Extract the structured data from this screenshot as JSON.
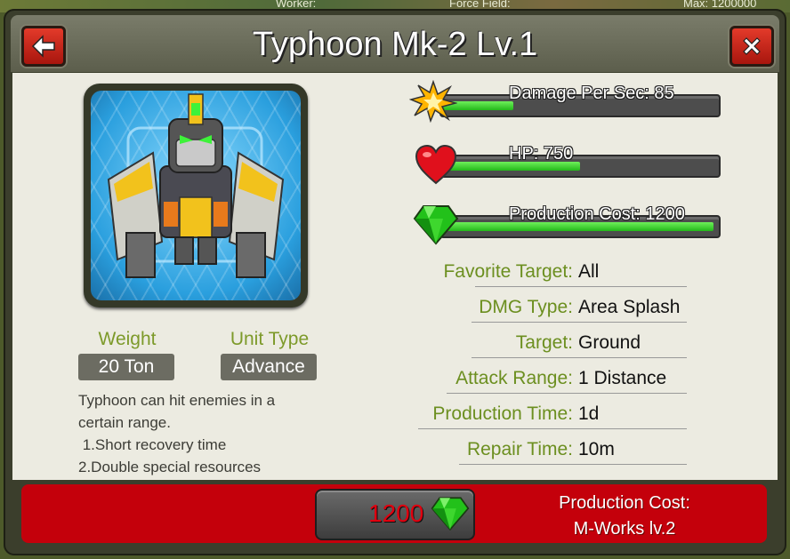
{
  "background": {
    "worker_label": "Worker:",
    "forcefield_label": "Force Field:",
    "max_label": "Max: 1200000"
  },
  "dialog": {
    "title": "Typhoon Mk-2  Lv.1",
    "back_icon": "back-arrow-icon",
    "close_icon": "close-x-icon"
  },
  "unit": {
    "weight_label": "Weight",
    "weight_value": "20 Ton",
    "type_label": "Unit Type",
    "type_value": "Advance",
    "description_lines": [
      "Typhoon can hit enemies in a",
      "certain range.",
      " 1.Short recovery time",
      "2.Double special resources"
    ]
  },
  "stats": [
    {
      "label": "Damage Per Sec: 85",
      "icon": "explosion-icon",
      "fill": 0.26
    },
    {
      "label": "HP: 750",
      "icon": "heart-icon",
      "fill": 0.5
    },
    {
      "label": "Production Cost: 1200",
      "icon": "gem-icon",
      "fill": 0.98
    }
  ],
  "info": [
    {
      "key": "Favorite Target:",
      "value": "All"
    },
    {
      "key": "DMG Type:",
      "value": "Area Splash"
    },
    {
      "key": "Target:",
      "value": "Ground"
    },
    {
      "key": "Attack Range:",
      "value": "1 Distance"
    },
    {
      "key": "Production Time:",
      "value": "1d"
    },
    {
      "key": "Repair Time:",
      "value": "10m"
    }
  ],
  "footer": {
    "cost_value": "1200",
    "cost_icon": "gem-icon",
    "production_label": "Production Cost:",
    "production_requirement": "M-Works lv.2"
  },
  "colors": {
    "accent_red": "#c4000b",
    "label_green": "#7d9a2a",
    "bar_green": "#3fd22e"
  }
}
